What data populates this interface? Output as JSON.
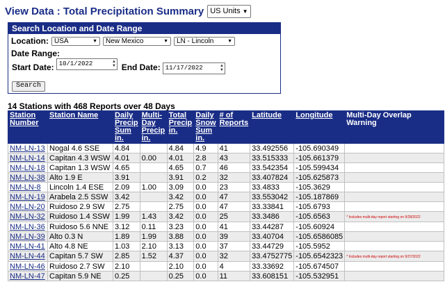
{
  "header": {
    "title": "View Data : Total Precipitation Summary",
    "units_selected": "US Units"
  },
  "search": {
    "title": "Search Location and Date Range",
    "location_label": "Location:",
    "country": "USA",
    "state": "New Mexico",
    "county": "LN - Lincoln",
    "date_range_label": "Date Range:",
    "start_label": "Start Date:",
    "start_value": "10/1/2022",
    "end_label": "End Date:",
    "end_value": "11/17/2022",
    "button_label": "Search"
  },
  "summary": "14 Stations with 468 Reports over 48 Days",
  "table": {
    "headers": [
      "Station Number",
      "Station Name",
      "Daily Precip Sum in.",
      "Multi-Day Precip in.",
      "Total Precip in.",
      "Daily Snow Sum in.",
      "# of Reports",
      "Latitude",
      "Longitude",
      "Multi-Day Overlap Warning"
    ],
    "rows": [
      [
        "NM-LN-13",
        "Nogal 4.6 SSE",
        "4.84",
        "",
        "4.84",
        "4.9",
        "41",
        "33.492556",
        "-105.690349",
        ""
      ],
      [
        "NM-LN-14",
        "Capitan 4.3 WSW",
        "4.01",
        "0.00",
        "4.01",
        "2.8",
        "43",
        "33.515333",
        "-105.661379",
        ""
      ],
      [
        "NM-LN-18",
        "Capitan 1.3 WSW",
        "4.65",
        "",
        "4.65",
        "0.7",
        "46",
        "33.542354",
        "-105.599434",
        ""
      ],
      [
        "NM-LN-38",
        "Alto 1.9 E",
        "3.91",
        "",
        "3.91",
        "0.2",
        "32",
        "33.407824",
        "-105.625873",
        ""
      ],
      [
        "NM-LN-8",
        "Lincoln 1.4 ESE",
        "2.09",
        "1.00",
        "3.09",
        "0.0",
        "23",
        "33.4833",
        "-105.3629",
        ""
      ],
      [
        "NM-LN-19",
        "Arabela 2.5 SSW",
        "3.42",
        "",
        "3.42",
        "0.0",
        "47",
        "33.553042",
        "-105.187869",
        ""
      ],
      [
        "NM-LN-20",
        "Ruidoso 2.9 SW",
        "2.75",
        "",
        "2.75",
        "0.0",
        "47",
        "33.33841",
        "-105.6793",
        ""
      ],
      [
        "NM-LN-32",
        "Ruidoso 1.4 SSW",
        "1.99",
        "1.43",
        "3.42",
        "0.0",
        "25",
        "33.3486",
        "-105.6563",
        "* Includes multi-day report starting on 9/28/2022"
      ],
      [
        "NM-LN-36",
        "Ruidoso 5.6 NNE",
        "3.12",
        "0.11",
        "3.23",
        "0.0",
        "41",
        "33.44287",
        "-105.60924",
        ""
      ],
      [
        "NM-LN-39",
        "Alto 0.3 N",
        "1.89",
        "1.99",
        "3.88",
        "0.0",
        "39",
        "33.40704",
        "-105.6586085",
        ""
      ],
      [
        "NM-LN-41",
        "Alto 4.8 NE",
        "1.03",
        "2.10",
        "3.13",
        "0.0",
        "37",
        "33.44729",
        "-105.5952",
        ""
      ],
      [
        "NM-LN-44",
        "Capitan 5.7 SW",
        "2.85",
        "1.52",
        "4.37",
        "0.0",
        "32",
        "33.4752775",
        "-105.6542323",
        "* Includes multi-day report starting on 9/27/2022"
      ],
      [
        "NM-LN-46",
        "Ruidoso 2.7 SW",
        "2.10",
        "",
        "2.10",
        "0.0",
        "4",
        "33.33692",
        "-105.674507",
        ""
      ],
      [
        "NM-LN-47",
        "Capitan 5.9 NE",
        "0.25",
        "",
        "0.25",
        "0.0",
        "11",
        "33.608151",
        "-105.532951",
        ""
      ]
    ]
  }
}
